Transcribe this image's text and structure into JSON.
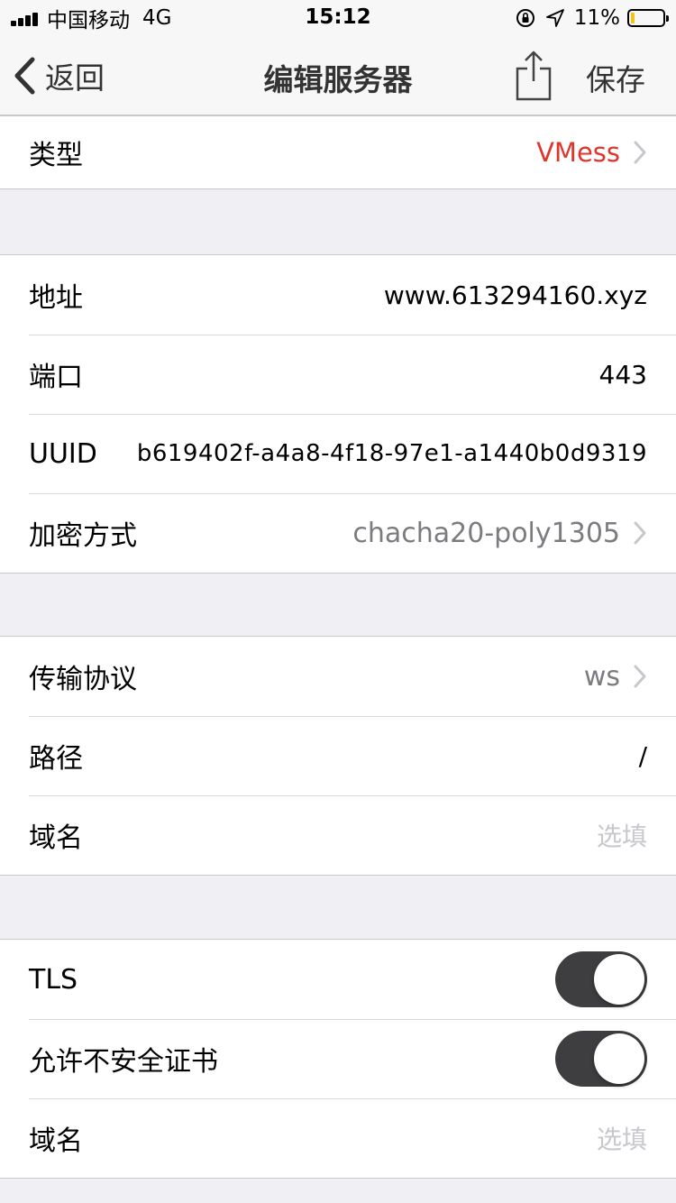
{
  "status_bar": {
    "carrier": "中国移动",
    "network": "4G",
    "time": "15:12",
    "battery_text": "11%",
    "battery_level": 0.11,
    "battery_color": "#f2c318"
  },
  "nav": {
    "back_label": "返回",
    "title": "编辑服务器",
    "share_icon": "share-icon",
    "save_label": "保存"
  },
  "type_section": {
    "label": "类型",
    "value": "VMess",
    "value_color": "#e0352b"
  },
  "server_section": {
    "address": {
      "label": "地址",
      "value": "www.613294160.xyz"
    },
    "port": {
      "label": "端口",
      "value": "443"
    },
    "uuid": {
      "label": "UUID",
      "value": "b619402f-a4a8-4f18-97e1-a1440b0d9319"
    },
    "encryption": {
      "label": "加密方式",
      "value": "chacha20-poly1305"
    }
  },
  "transport_section": {
    "protocol": {
      "label": "传输协议",
      "value": "ws"
    },
    "path": {
      "label": "路径",
      "value": "/"
    },
    "host": {
      "label": "域名",
      "placeholder": "选填"
    }
  },
  "tls_section": {
    "tls": {
      "label": "TLS",
      "enabled": true
    },
    "allow_insecure": {
      "label": "允许不安全证书",
      "enabled": true
    },
    "sni": {
      "label": "域名",
      "placeholder": "选填"
    }
  }
}
